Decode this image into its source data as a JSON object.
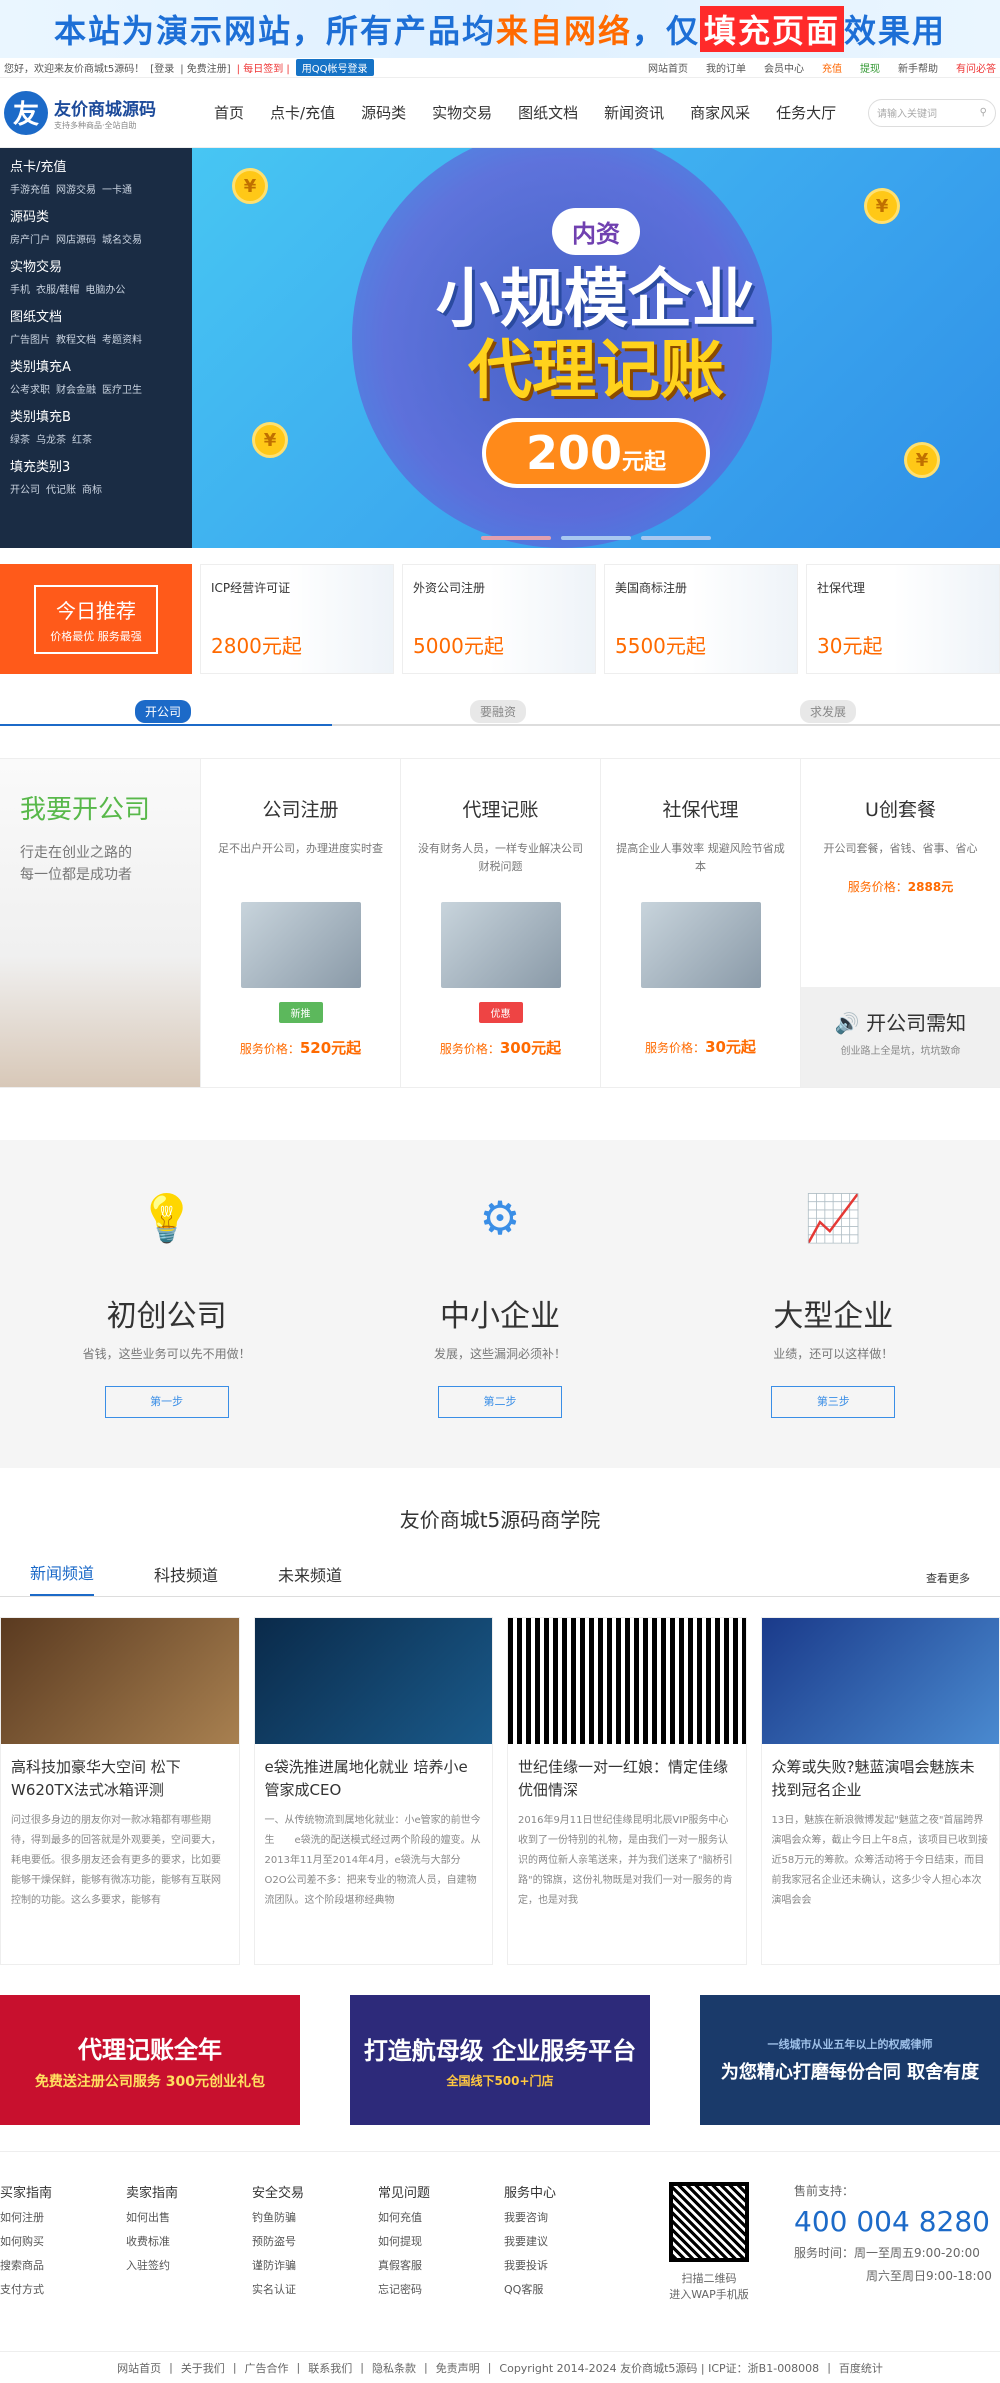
{
  "banner_top": {
    "a": "本站为演示网站，所有产品均",
    "b": "来自网络",
    "c": "，仅",
    "d": "填充页面",
    "e": "效果用"
  },
  "topbar": {
    "welcome": "您好，欢迎来友价商城t5源码！",
    "login": "[登录",
    "reg": "| 免费注册]",
    "sign": "| 每日签到 |",
    "qq": "用QQ帐号登录",
    "links": [
      "网站首页",
      "我的订单",
      "会员中心",
      "充值",
      "提现",
      "新手帮助",
      "有问必答"
    ]
  },
  "header": {
    "logo_mark": "友",
    "logo_title": "友价商城源码",
    "logo_sub": "支持多种商品·全站自助",
    "nav": [
      "首页",
      "点卡/充值",
      "源码类",
      "实物交易",
      "图纸文档",
      "新闻资讯",
      "商家风采",
      "任务大厅"
    ],
    "search_ph": "请输入关键词"
  },
  "sidebar": [
    {
      "h": "点卡/充值",
      "subs": [
        "手游充值",
        "网游交易",
        "一卡通"
      ]
    },
    {
      "h": "源码类",
      "subs": [
        "房产门户",
        "网店源码",
        "城名交易"
      ]
    },
    {
      "h": "实物交易",
      "subs": [
        "手机",
        "衣服/鞋帽",
        "电脑办公"
      ]
    },
    {
      "h": "图纸文档",
      "subs": [
        "广告图片",
        "教程文档",
        "考题资料"
      ]
    },
    {
      "h": "类别填充A",
      "subs": [
        "公考求职",
        "财会金融",
        "医疗卫生"
      ]
    },
    {
      "h": "类别填充B",
      "subs": [
        "绿茶",
        "乌龙茶",
        "红茶"
      ]
    },
    {
      "h": "填充类别3",
      "subs": [
        "开公司",
        "代记账",
        "商标"
      ]
    }
  ],
  "hero": {
    "tag": "内资",
    "line1": "小规模企业",
    "line2": "代理记账",
    "price": "200",
    "unit": "元起"
  },
  "rec": {
    "title": "今日推荐",
    "sub": "价格最优 服务最强",
    "items": [
      {
        "n": "ICP经营许可证",
        "p": "2800元起"
      },
      {
        "n": "外资公司注册",
        "p": "5000元起"
      },
      {
        "n": "美国商标注册",
        "p": "5500元起"
      },
      {
        "n": "社保代理",
        "p": "30元起"
      }
    ]
  },
  "steps": [
    "开公司",
    "要融资",
    "求发展"
  ],
  "services": {
    "intro_title": "我要开公司",
    "intro_sub1": "行走在创业之路的",
    "intro_sub2": "每一位都是成功者",
    "items": [
      {
        "t": "公司注册",
        "d": "足不出户开公司，办理进度实时查",
        "badge": "新推",
        "badge_color": "#5cb85c",
        "label": "服务价格：",
        "price": "520元起"
      },
      {
        "t": "代理记账",
        "d": "没有财务人员，一样专业解决公司财税问题",
        "badge": "优惠",
        "badge_color": "#e44",
        "label": "服务价格：",
        "price": "300元起"
      },
      {
        "t": "社保代理",
        "d": "提高企业人事效率 规避风险节省成本",
        "badge": "",
        "badge_color": "#fff",
        "label": "服务价格：",
        "price": "30元起"
      }
    ],
    "last": {
      "t": "U创套餐",
      "d": "开公司套餐，省钱、省事、省心",
      "label": "服务价格：",
      "price": "2888元",
      "bot_t": "开公司需知",
      "bot_s": "创业路上全是坑，坑坑致命"
    }
  },
  "stages": [
    {
      "t": "初创公司",
      "d": "省钱，这些业务可以先不用做！",
      "btn": "第一步"
    },
    {
      "t": "中小企业",
      "d": "发展，这些漏洞必须补！",
      "btn": "第二步"
    },
    {
      "t": "大型企业",
      "d": "业绩，还可以这样做！",
      "btn": "第三步"
    }
  ],
  "news": {
    "title": "友价商城t5源码商学院",
    "tabs": [
      "新闻频道",
      "科技频道",
      "未来频道"
    ],
    "more": "查看更多",
    "cards": [
      {
        "t": "高科技加豪华大空间 松下W620TX法式冰箱评测",
        "b": "问过很多身边的朋友你对一款冰箱都有哪些期待，得到最多的回答就是外观要美，空间要大，耗电要低。很多朋友还会有更多的要求，比如要能够干燥保鲜，能够有微冻功能，能够有互联网控制的功能。这么多要求，能够有"
      },
      {
        "t": "e袋洗推进属地化就业 培养小e管家成CEO",
        "b": "一、从传统物流到属地化就业：小e管家的前世今生　　e袋洗的配送模式经过两个阶段的嬗变。从2013年11月至2014年4月，e袋洗与大部分O2O公司差不多：把来专业的物流人员，自建物流团队。这个阶段堪称经典物"
      },
      {
        "t": "世纪佳缘一对一红娘：情定佳缘 优佃情深",
        "b": "2016年9月11日世纪佳缘昆明北辰VIP服务中心收到了一份特别的礼物，是由我们一对一服务认识的两位新人亲笔送来，并为我们送来了\"脑桥引路\"的锦旗，这份礼物既是对我们一对一服务的肯定，也是对我"
      },
      {
        "t": "众筹或失败?魅蓝演唱会魅族未找到冠名企业",
        "b": "13日，魅族在新浪微博发起\"魅蓝之夜\"首届跨界演唱会众筹，截止今日上午8点，该项目已收到接近58万元的筹款。众筹活动将于今日结束，而目前我家冠名企业还未确认，这多少令人担心本次演唱会会"
      }
    ]
  },
  "ads": [
    {
      "t": "代理记账全年",
      "s": "免费送注册公司服务 300元创业礼包",
      "color": "#c8102e"
    },
    {
      "t": "打造航母级 企业服务平台",
      "s": "全国线下500+门店",
      "color": "#2d2a7a"
    },
    {
      "t": "为您精心打磨每份合同 取舍有度",
      "s": "一线城市从业五年以上的权威律师",
      "color": "#1a3a6a"
    }
  ],
  "footer": {
    "cols": [
      {
        "h": "买家指南",
        "i": [
          "如何注册",
          "如何购买",
          "搜索商品",
          "支付方式"
        ]
      },
      {
        "h": "卖家指南",
        "i": [
          "如何出售",
          "收费标准",
          "入驻签约"
        ]
      },
      {
        "h": "安全交易",
        "i": [
          "钓鱼防骗",
          "预防盗号",
          "谨防诈骗",
          "实名认证"
        ]
      },
      {
        "h": "常见问题",
        "i": [
          "如何充值",
          "如何提现",
          "真假客服",
          "忘记密码"
        ]
      },
      {
        "h": "服务中心",
        "i": [
          "我要咨询",
          "我要建议",
          "我要投诉",
          "QQ客服"
        ]
      }
    ],
    "qr_t1": "扫描二维码",
    "qr_t2": "进入WAP手机版",
    "contact_h": "售前支持：",
    "phone": "400 004 8280",
    "time1": "服务时间：周一至周五9:00-20:00",
    "time2": "周六至周日9:00-18:00",
    "links": [
      "网站首页",
      "关于我们",
      "广告合作",
      "联系我们",
      "隐私条款",
      "免责声明",
      "Copyright 2014-2024 友价商城t5源码 | ICP证：浙B1-008008",
      "百度统计"
    ]
  }
}
